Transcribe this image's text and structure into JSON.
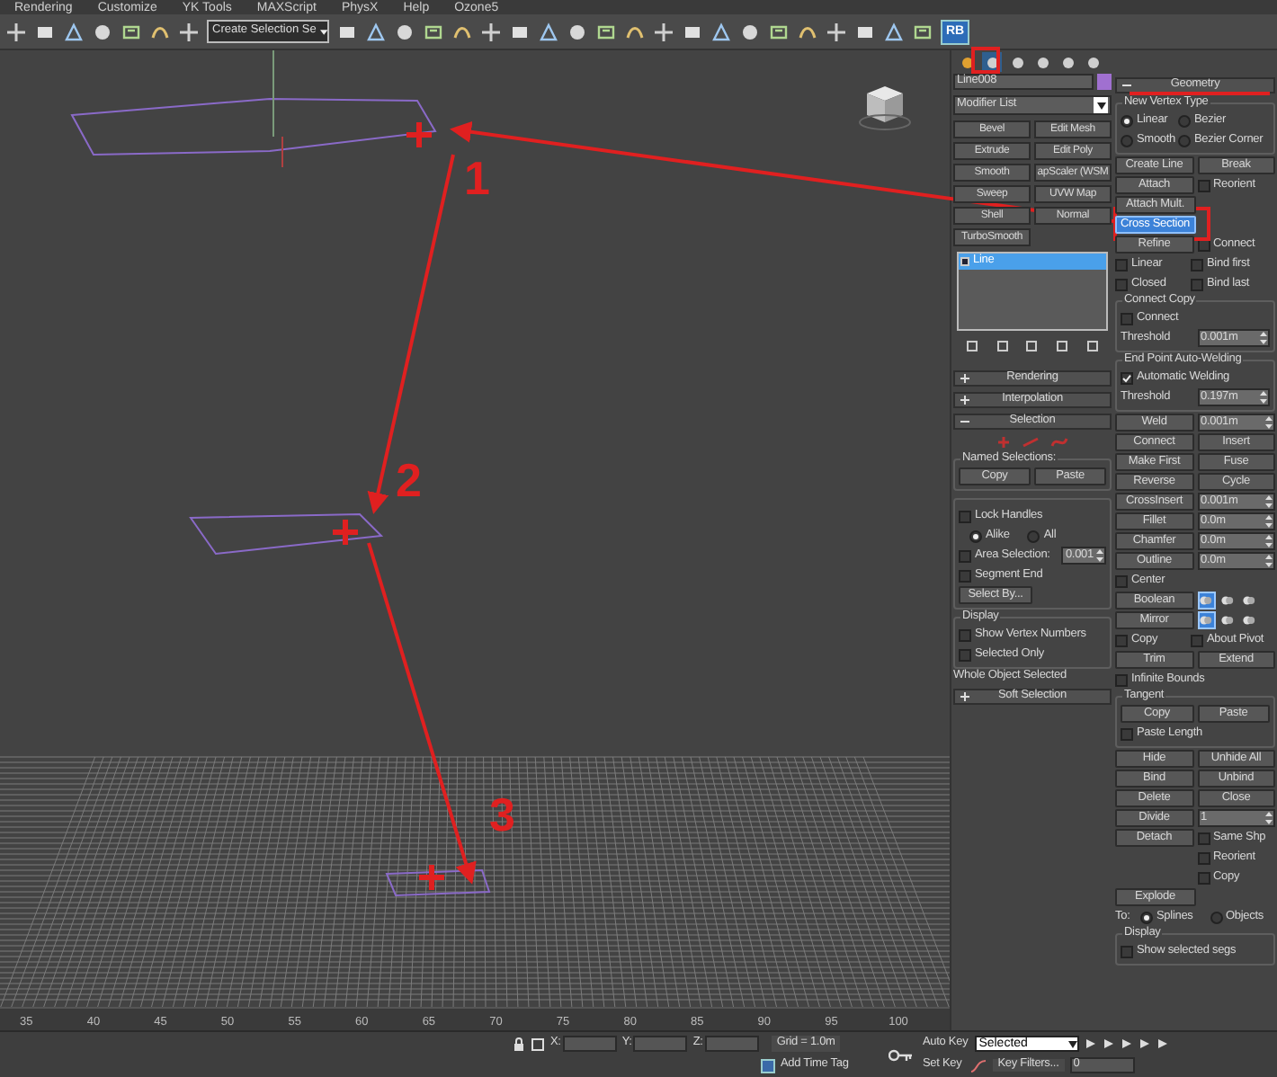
{
  "menu": [
    "Rendering",
    "Customize",
    "YK Tools",
    "MAXScript",
    "PhysX",
    "Help",
    "Ozone5"
  ],
  "toolbar": {
    "selection_set": "Create Selection Se",
    "script_button": "RB"
  },
  "viewport": {
    "markers": [
      {
        "label": "1"
      },
      {
        "label": "2"
      },
      {
        "label": "3"
      }
    ]
  },
  "command_tabs": [
    {
      "selected": false
    },
    {
      "selected": true
    },
    {
      "selected": false
    },
    {
      "selected": false
    },
    {
      "selected": false
    },
    {
      "selected": false
    }
  ],
  "object": {
    "name": "Line008",
    "color": "#a070d0"
  },
  "modifier_list": "Modifier List",
  "modifier_buttons": [
    "Bevel",
    "Edit Mesh",
    "Extrude",
    "Edit Poly",
    "Smooth",
    "apScaler (WSM",
    "Sweep",
    "UVW Map",
    "Shell",
    "Normal",
    "TurboSmooth"
  ],
  "stack": [
    {
      "label": "Line",
      "selected": true
    }
  ],
  "left_rollouts": [
    {
      "title": "Rendering",
      "expanded": false
    },
    {
      "title": "Interpolation",
      "expanded": false
    },
    {
      "title": "Selection",
      "expanded": true,
      "rows": [
        {
          "kind": "subobject_icons"
        },
        {
          "kind": "group",
          "title": "Named Selections:",
          "rows": [
            {
              "cells": [
                {
                  "kind": "button",
                  "label": "Copy",
                  "selected": false
                },
                {
                  "kind": "button",
                  "label": "Paste",
                  "selected": false
                }
              ]
            }
          ]
        },
        {
          "kind": "group",
          "rows": [
            {
              "cells": [
                {
                  "kind": "check",
                  "label": "Lock Handles",
                  "checked": false
                }
              ]
            },
            {
              "kind": "radio_group",
              "options": [
                {
                  "label": "Alike",
                  "selected": true
                },
                {
                  "label": "All",
                  "selected": false
                }
              ]
            },
            {
              "cells": [
                {
                  "kind": "check",
                  "label": "Area Selection:",
                  "checked": false
                },
                {
                  "kind": "spinner",
                  "value": "0.001"
                }
              ]
            },
            {
              "cells": [
                {
                  "kind": "check",
                  "label": "Segment End",
                  "checked": false
                }
              ]
            },
            {
              "cells": [
                {
                  "kind": "button",
                  "label": "Select By...",
                  "selected": false
                }
              ]
            }
          ]
        },
        {
          "kind": "group",
          "title": "Display",
          "rows": [
            {
              "cells": [
                {
                  "kind": "check",
                  "label": "Show Vertex Numbers",
                  "checked": false
                }
              ]
            },
            {
              "cells": [
                {
                  "kind": "check",
                  "label": "Selected Only",
                  "checked": false
                }
              ]
            }
          ]
        },
        {
          "cells": [
            {
              "kind": "text",
              "label": "Whole Object Selected"
            }
          ]
        }
      ]
    },
    {
      "title": "Soft Selection",
      "expanded": false
    }
  ],
  "right_rollouts": [
    {
      "title": "Geometry",
      "expanded": true,
      "rows": [
        {
          "kind": "group",
          "title": "New Vertex Type",
          "rows": [
            {
              "cells": [
                {
                  "kind": "radio",
                  "label": "Linear",
                  "selected": true
                },
                {
                  "kind": "radio",
                  "label": "Bezier",
                  "selected": false
                }
              ]
            },
            {
              "cells": [
                {
                  "kind": "radio",
                  "label": "Smooth",
                  "selected": false
                },
                {
                  "kind": "radio",
                  "label": "Bezier Corner",
                  "selected": false
                }
              ]
            }
          ]
        },
        {
          "cells": [
            {
              "kind": "button",
              "label": "Create Line",
              "selected": false
            },
            {
              "kind": "button",
              "label": "Break",
              "selected": false
            }
          ]
        },
        {
          "cells": [
            {
              "kind": "button",
              "label": "Attach",
              "selected": false
            },
            {
              "kind": "check",
              "label": "Reorient",
              "checked": false
            }
          ]
        },
        {
          "cells": [
            {
              "kind": "button",
              "label": "Attach Mult.",
              "selected": false
            }
          ]
        },
        {
          "cells": [
            {
              "kind": "button",
              "label": "Cross Section",
              "selected": true
            }
          ]
        },
        {
          "cells": [
            {
              "kind": "button",
              "label": "Refine",
              "selected": false
            },
            {
              "kind": "check",
              "label": "Connect",
              "checked": false
            }
          ]
        },
        {
          "cells": [
            {
              "kind": "check",
              "label": "Linear",
              "checked": false
            },
            {
              "kind": "check",
              "label": "Bind first",
              "checked": false
            }
          ]
        },
        {
          "cells": [
            {
              "kind": "check",
              "label": "Closed",
              "checked": false
            },
            {
              "kind": "check",
              "label": "Bind last",
              "checked": false
            }
          ]
        },
        {
          "kind": "group",
          "title": "Connect Copy",
          "rows": [
            {
              "cells": [
                {
                  "kind": "check",
                  "label": "Connect",
                  "checked": false
                }
              ]
            },
            {
              "cells": [
                {
                  "kind": "text",
                  "label": "Threshold"
                },
                {
                  "kind": "spinner",
                  "value": "0.001m"
                }
              ]
            }
          ]
        },
        {
          "kind": "group",
          "title": "End Point Auto-Welding",
          "rows": [
            {
              "cells": [
                {
                  "kind": "check",
                  "label": "Automatic Welding",
                  "checked": true
                }
              ]
            },
            {
              "cells": [
                {
                  "kind": "text",
                  "label": "Threshold"
                },
                {
                  "kind": "spinner",
                  "value": "0.197m"
                }
              ]
            }
          ]
        },
        {
          "cells": [
            {
              "kind": "button",
              "label": "Weld",
              "selected": false
            },
            {
              "kind": "spinner",
              "value": "0.001m"
            }
          ]
        },
        {
          "cells": [
            {
              "kind": "button",
              "label": "Connect",
              "selected": false
            },
            {
              "kind": "button",
              "label": "Insert",
              "selected": false
            }
          ]
        },
        {
          "cells": [
            {
              "kind": "button",
              "label": "Make First",
              "selected": false
            },
            {
              "kind": "button",
              "label": "Fuse",
              "selected": false
            }
          ]
        },
        {
          "cells": [
            {
              "kind": "button",
              "label": "Reverse",
              "selected": false
            },
            {
              "kind": "button",
              "label": "Cycle",
              "selected": false
            }
          ]
        },
        {
          "cells": [
            {
              "kind": "button",
              "label": "CrossInsert",
              "selected": false
            },
            {
              "kind": "spinner",
              "value": "0.001m"
            }
          ]
        },
        {
          "cells": [
            {
              "kind": "button",
              "label": "Fillet",
              "selected": false
            },
            {
              "kind": "spinner",
              "value": "0.0m"
            }
          ]
        },
        {
          "cells": [
            {
              "kind": "button",
              "label": "Chamfer",
              "selected": false
            },
            {
              "kind": "spinner",
              "value": "0.0m"
            }
          ]
        },
        {
          "cells": [
            {
              "kind": "button",
              "label": "Outline",
              "selected": false
            },
            {
              "kind": "spinner",
              "value": "0.0m"
            }
          ]
        },
        {
          "cells": [
            {
              "kind": "check",
              "label": "Center",
              "checked": false
            }
          ]
        },
        {
          "cells": [
            {
              "kind": "button",
              "label": "Boolean",
              "selected": false
            },
            {
              "kind": "toggles",
              "items": [
                {
                  "selected": true
                },
                {
                  "selected": false
                },
                {
                  "selected": false
                }
              ]
            }
          ]
        },
        {
          "cells": [
            {
              "kind": "button",
              "label": "Mirror",
              "selected": false
            },
            {
              "kind": "toggles",
              "items": [
                {
                  "selected": true
                },
                {
                  "selected": false
                },
                {
                  "selected": false
                }
              ]
            }
          ]
        },
        {
          "cells": [
            {
              "kind": "check",
              "label": "Copy",
              "checked": false
            },
            {
              "kind": "check",
              "label": "About Pivot",
              "checked": false
            }
          ]
        },
        {
          "cells": [
            {
              "kind": "button",
              "label": "Trim",
              "selected": false
            },
            {
              "kind": "button",
              "label": "Extend",
              "selected": false
            }
          ]
        },
        {
          "cells": [
            {
              "kind": "check",
              "label": "Infinite Bounds",
              "checked": false
            }
          ]
        },
        {
          "kind": "group",
          "title": "Tangent",
          "rows": [
            {
              "cells": [
                {
                  "kind": "button",
                  "label": "Copy",
                  "selected": false
                },
                {
                  "kind": "button",
                  "label": "Paste",
                  "selected": false
                }
              ]
            },
            {
              "cells": [
                {
                  "kind": "check",
                  "label": "Paste Length",
                  "checked": false
                }
              ]
            }
          ]
        },
        {
          "cells": [
            {
              "kind": "button",
              "label": "Hide",
              "selected": false
            },
            {
              "kind": "button",
              "label": "Unhide All",
              "selected": false
            }
          ]
        },
        {
          "cells": [
            {
              "kind": "button",
              "label": "Bind",
              "selected": false
            },
            {
              "kind": "button",
              "label": "Unbind",
              "selected": false
            }
          ]
        },
        {
          "cells": [
            {
              "kind": "button",
              "label": "Delete",
              "selected": false
            },
            {
              "kind": "button",
              "label": "Close",
              "selected": false
            }
          ]
        },
        {
          "cells": [
            {
              "kind": "button",
              "label": "Divide",
              "selected": false
            },
            {
              "kind": "spinner",
              "value": "1"
            }
          ]
        },
        {
          "cells": [
            {
              "kind": "button",
              "label": "Detach",
              "selected": false
            },
            {
              "kind": "check",
              "label": "Same Shp",
              "checked": false
            }
          ]
        },
        {
          "cells": [
            {
              "kind": "spacer"
            },
            {
              "kind": "check",
              "label": "Reorient",
              "checked": false
            }
          ]
        },
        {
          "cells": [
            {
              "kind": "spacer"
            },
            {
              "kind": "check",
              "label": "Copy",
              "checked": false
            }
          ]
        },
        {
          "cells": [
            {
              "kind": "button",
              "label": "Explode",
              "selected": false
            }
          ]
        },
        {
          "cells": [
            {
              "kind": "text",
              "label": "To:"
            },
            {
              "kind": "radio",
              "label": "Splines",
              "selected": true
            },
            {
              "kind": "radio",
              "label": "Objects",
              "selected": false
            }
          ]
        },
        {
          "kind": "group",
          "title": "Display",
          "rows": [
            {
              "cells": [
                {
                  "kind": "check",
                  "label": "Show selected segs",
                  "checked": false
                }
              ]
            }
          ]
        }
      ]
    }
  ],
  "timeline": [
    "35",
    "40",
    "45",
    "50",
    "55",
    "60",
    "65",
    "70",
    "75",
    "80",
    "85",
    "90",
    "95",
    "100"
  ],
  "status": {
    "x_label": "X:",
    "y_label": "Y:",
    "z_label": "Z:",
    "grid": "Grid = 1.0m",
    "time_tag": "Add Time Tag",
    "auto_key": "Auto Key",
    "key_mode": "Selected",
    "set_key": "Set Key",
    "key_filters": "Key Filters...",
    "frame": "0"
  }
}
